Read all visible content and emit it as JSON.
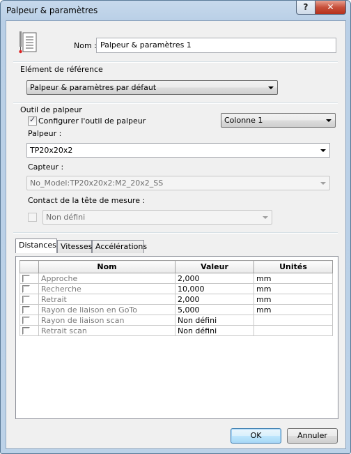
{
  "window": {
    "title": "Palpeur & paramètres",
    "help_icon": "?",
    "close_icon": "✕"
  },
  "name": {
    "label": "Nom :",
    "value": "Palpeur & paramètres 1"
  },
  "reference": {
    "group_label": "Elément de référence",
    "selected": "Palpeur & paramètres par défaut"
  },
  "probe_tool": {
    "group_label": "Outil de palpeur",
    "configure_label": "Configurer l'outil de palpeur",
    "configure_checked": true,
    "column_selected": "Colonne 1",
    "probe_label": "Palpeur :",
    "probe_selected": "TP20x20x2",
    "sensor_label": "Capteur :",
    "sensor_selected": "No_Model:TP20x20x2:M2_20x2_SS",
    "contact_label": "Contact de la tête de mesure :",
    "contact_checked": false,
    "contact_selected": "Non défini"
  },
  "tabs": [
    {
      "label": "Distances",
      "active": true
    },
    {
      "label": "Vitesses",
      "active": false
    },
    {
      "label": "Accélérations",
      "active": false
    }
  ],
  "table": {
    "headers": [
      "Nom",
      "Valeur",
      "Unités"
    ],
    "rows": [
      {
        "name": "Approche",
        "value": "2,000",
        "unit": "mm"
      },
      {
        "name": "Recherche",
        "value": "10,000",
        "unit": "mm"
      },
      {
        "name": "Retrait",
        "value": "2,000",
        "unit": "mm"
      },
      {
        "name": "Rayon de liaison en GoTo",
        "value": "5,000",
        "unit": "mm"
      },
      {
        "name": "Rayon de liaison scan",
        "value": "Non défini",
        "unit": ""
      },
      {
        "name": "Retrait scan",
        "value": "Non défini",
        "unit": ""
      }
    ]
  },
  "buttons": {
    "ok": "OK",
    "cancel": "Annuler"
  },
  "icons": {
    "probe": "probe-settings-icon",
    "check": "✓"
  },
  "colors": {
    "accent": "#3c7fb1",
    "titlebar": "#c7d9ec",
    "close": "#c7503b"
  }
}
